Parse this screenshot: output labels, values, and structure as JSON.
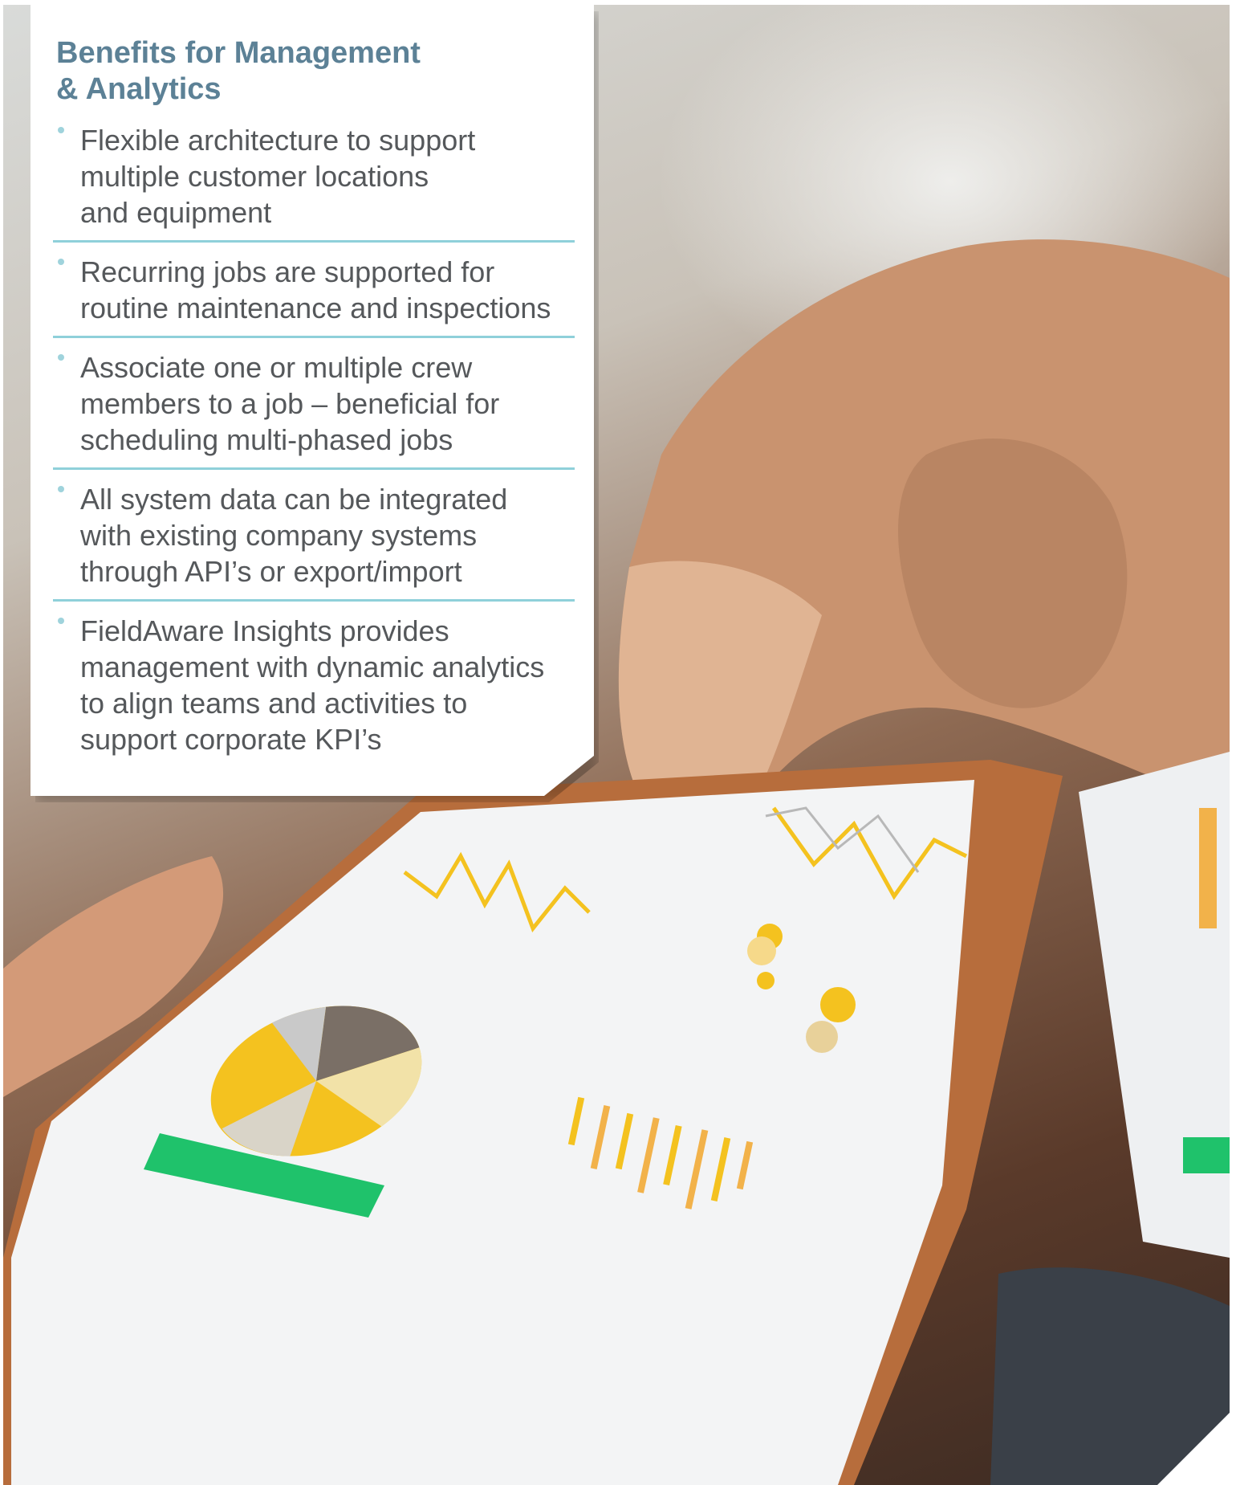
{
  "card": {
    "title": "Benefits for Management\n& Analytics",
    "bullets": [
      "Flexible architecture to support\nmultiple customer locations\nand equipment",
      "Recurring jobs are supported for\nroutine maintenance and inspections",
      "Associate one or multiple crew\nmembers to a job – beneficial for\nscheduling multi-phased jobs",
      "All system data can be integrated\nwith existing company systems\nthrough API’s or export/import",
      "FieldAware Insights provides\nmanagement with dynamic analytics\nto align teams and activities to\nsupport corporate KPI’s"
    ]
  },
  "photo": {
    "description_icon": "hand-on-phone-analytics-photo",
    "phone_button_color": "#1fc26b",
    "chart_accent_color": "#f4c21f"
  },
  "colors": {
    "title": "#5c8196",
    "body_text": "#55585b",
    "divider": "#8fd0da",
    "bullet": "#9fd3dc"
  }
}
